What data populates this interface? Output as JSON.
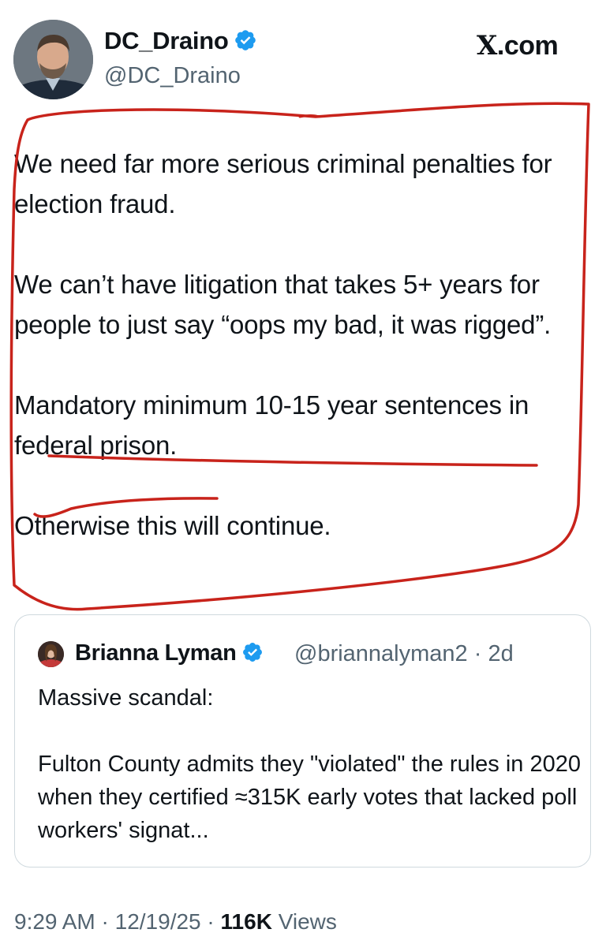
{
  "author": {
    "display_name": "DC_Draino",
    "handle": "@DC_Draino",
    "verified_icon": "verified-badge-icon",
    "avatar_icon": "profile-photo-avatar"
  },
  "site_label": "X.com",
  "tweet": {
    "paragraphs": [
      "We need far more serious criminal penalties for election fraud.",
      "We can’t have litigation that takes 5+ years for people to just say “oops my bad, it was rigged”.",
      "Mandatory minimum 10-15 year sentences in federal prison.",
      "Otherwise this will continue."
    ],
    "annotation_color": "#c8231b"
  },
  "quoted_tweet": {
    "display_name": "Brianna Lyman",
    "handle": "@briannalyman2",
    "age": "2d",
    "verified_icon": "verified-badge-icon",
    "paragraphs": [
      "Massive scandal:",
      "Fulton County admits they \"violated\" the rules in 2020 when they certified ≈315K early votes that lacked poll workers' signat..."
    ]
  },
  "meta": {
    "time": "9:29 AM",
    "date": "12/19/25",
    "views_count": "116K",
    "views_label": "Views"
  },
  "colors": {
    "verified": "#1d9bf0",
    "secondary_text": "#536471",
    "primary_text": "#0f1419",
    "border": "#cfd9de"
  }
}
